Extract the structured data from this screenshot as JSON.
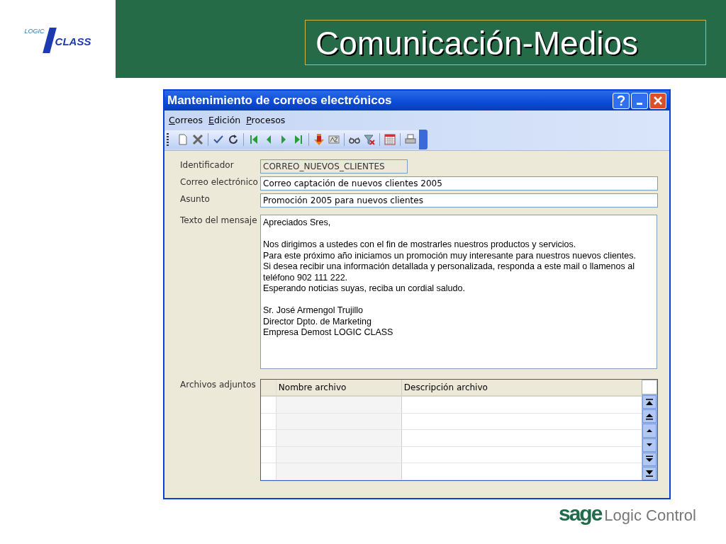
{
  "logo": {
    "small": "LOGIC",
    "large": "CLASS"
  },
  "slide_title": "Comunicación-Medios",
  "window": {
    "title": "Mantenimiento de correos electrónicos"
  },
  "menu": [
    "Correos",
    "Edición",
    "Procesos"
  ],
  "form": {
    "fields": [
      {
        "label": "Identificador",
        "value": "CORREO_NUEVOS_CLIENTES",
        "disabled": true
      },
      {
        "label": "Correo electrónico",
        "value": "Correo captación de nuevos clientes 2005",
        "disabled": false
      },
      {
        "label": "Asunto",
        "value": "Promoción 2005 para nuevos clientes",
        "disabled": false
      }
    ],
    "message": {
      "label": "Texto del mensaje",
      "paragraphs": [
        [
          "Apreciados Sres,"
        ],
        [
          "Nos dirigimos a ustedes con el fin de mostrarles nuestros productos y servicios.",
          "Para este próximo año iniciamos un promoción muy interesante para nuestros nuevos clientes.",
          "Si desea recibir una información detallada y personalizada, responda a este mail o llamenos al teléfono 902 111 222.",
          "Esperando noticias suyas, reciba un cordial saludo."
        ],
        [
          "Sr. José Armengol Trujillo",
          "Director Dpto. de Marketing",
          "Empresa Demost LOGIC CLASS"
        ]
      ]
    },
    "attachments": {
      "label": "Archivos adjuntos",
      "columns": [
        "Nombre archivo",
        "Descripción archivo"
      ]
    }
  },
  "footer_logo": {
    "brand": "sage",
    "product": "Logic Control"
  }
}
